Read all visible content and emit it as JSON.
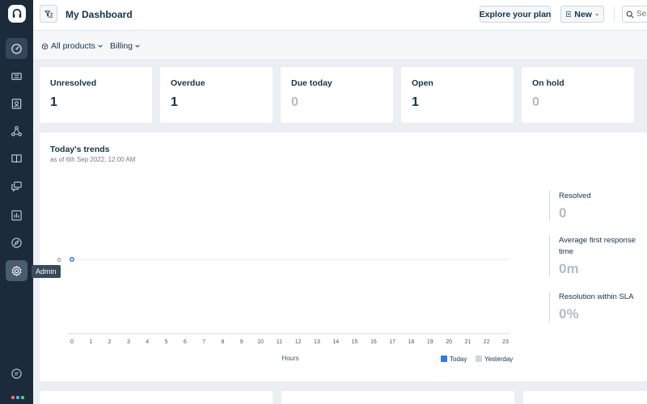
{
  "app": {
    "page_title": "My Dashboard"
  },
  "sidebar": {
    "items": [
      {
        "name": "dashboard-icon",
        "active": true
      },
      {
        "name": "tickets-icon"
      },
      {
        "name": "contacts-icon"
      },
      {
        "name": "groups-icon"
      },
      {
        "name": "knowledge-base-icon"
      },
      {
        "name": "discussions-icon"
      },
      {
        "name": "reports-icon"
      },
      {
        "name": "discover-icon"
      },
      {
        "name": "admin-gear-icon",
        "hover": true
      },
      {
        "name": "chat-icon"
      }
    ],
    "tooltip": "Admin"
  },
  "header": {
    "explore_label": "Explore your plan",
    "new_label": "New",
    "search_placeholder": "Search"
  },
  "subbar": {
    "products_label": "All products",
    "billing_label": "Billing"
  },
  "cards": [
    {
      "label": "Unresolved",
      "value": "1",
      "muted": false
    },
    {
      "label": "Overdue",
      "value": "1",
      "muted": false
    },
    {
      "label": "Due today",
      "value": "0",
      "muted": true
    },
    {
      "label": "Open",
      "value": "1",
      "muted": false
    },
    {
      "label": "On hold",
      "value": "0",
      "muted": true
    }
  ],
  "trends": {
    "title": "Today's trends",
    "subtitle": "as of 6th Sep 2022, 12:00 AM",
    "metrics": [
      {
        "label": "Resolved",
        "value": "0"
      },
      {
        "label": "Average first response time",
        "value": "0m"
      },
      {
        "label": "Resolution within SLA",
        "value": "0%"
      }
    ]
  },
  "colors": {
    "sidebar_bg": "#1b2b3a",
    "today_series": "#2c7be5",
    "yesterday_series": "#cfd7df",
    "dark_value": "#12344d",
    "muted_value": "#b1bdc8"
  },
  "chart_data": {
    "type": "line",
    "x": [
      "0",
      "1",
      "2",
      "3",
      "4",
      "5",
      "6",
      "7",
      "8",
      "9",
      "10",
      "11",
      "12",
      "13",
      "14",
      "15",
      "16",
      "17",
      "18",
      "19",
      "20",
      "21",
      "22",
      "23"
    ],
    "xlabel": "Hours",
    "ylabel": "",
    "y_ticks": [
      "0"
    ],
    "series": [
      {
        "name": "Today",
        "values": [
          0
        ]
      },
      {
        "name": "Yesterday",
        "values": []
      }
    ],
    "legend": "bottom-right",
    "grid": false
  }
}
